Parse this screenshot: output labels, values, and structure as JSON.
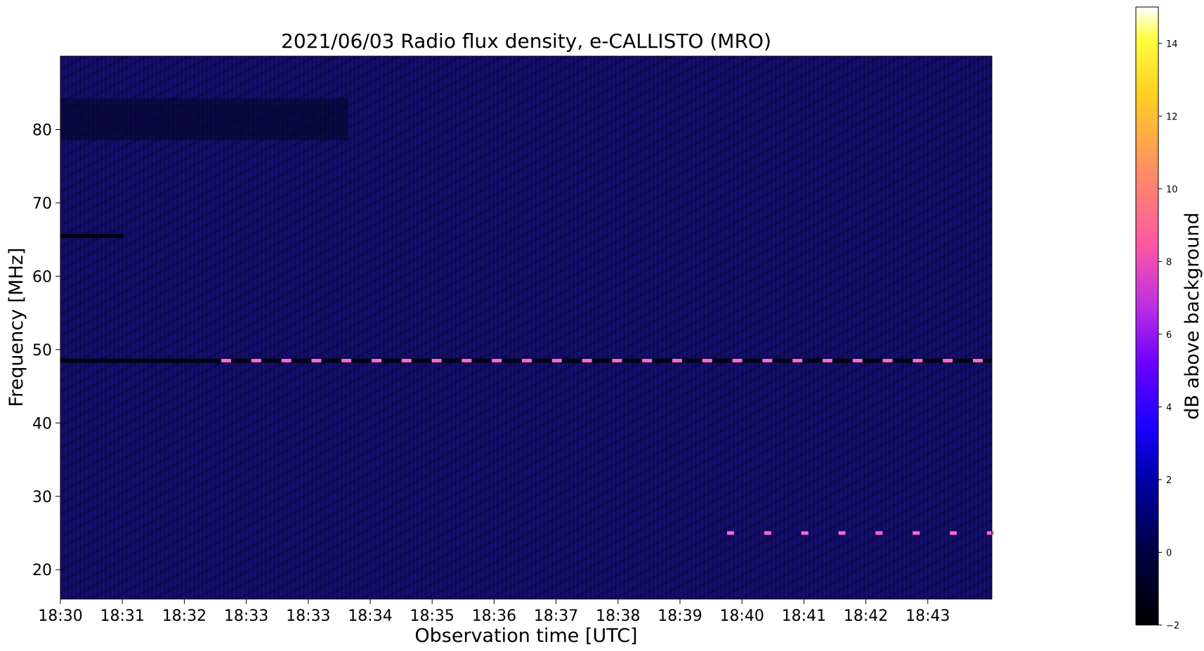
{
  "chart_data": {
    "type": "heatmap",
    "title": "2021/06/03  Radio flux density, e-CALLISTO (MRO)",
    "xlabel": "Observation time [UTC]",
    "ylabel": "Frequency [MHz]",
    "x_tick_labels": [
      "18:30",
      "18:31",
      "18:32",
      "18:33",
      "18:33",
      "18:34",
      "18:35",
      "18:36",
      "18:37",
      "18:38",
      "18:39",
      "18:40",
      "18:41",
      "18:42",
      "18:43"
    ],
    "y_ticks": [
      20,
      30,
      40,
      50,
      60,
      70,
      80
    ],
    "ylim": [
      16,
      90
    ],
    "colorbar": {
      "label": "dB above background",
      "ticks": [
        -2,
        0,
        2,
        4,
        6,
        8,
        10,
        12,
        14
      ],
      "range": [
        -2,
        15
      ],
      "colormap": "gnuplot2"
    },
    "background_level_db": 0,
    "bright_features": [
      {
        "kind": "band",
        "frequency_mhz": 48.5,
        "description_level_db": 8
      },
      {
        "kind": "band",
        "frequency_mhz": 25,
        "description_level_db": 8
      }
    ],
    "dark_features": [
      {
        "kind": "band",
        "frequency_mhz": 48.5
      },
      {
        "kind": "band",
        "frequency_mhz": 65.5
      }
    ]
  }
}
